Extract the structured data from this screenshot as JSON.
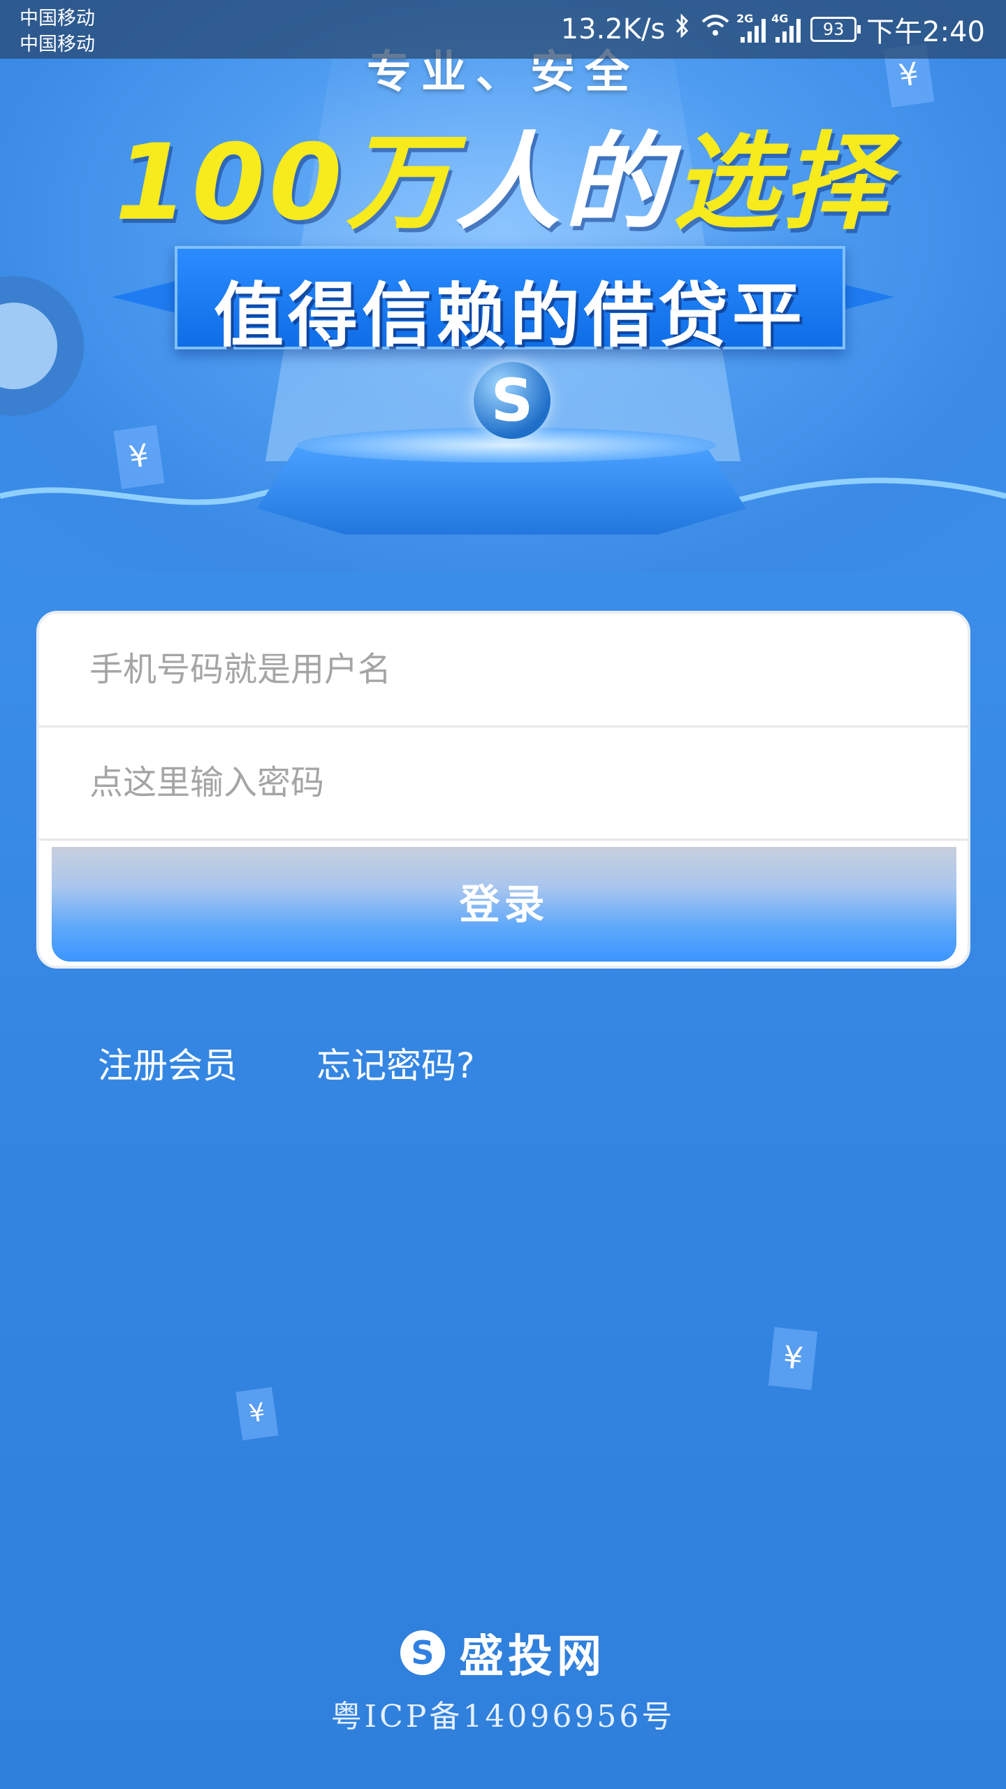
{
  "status_bar": {
    "carrier_1": "中国移动",
    "carrier_2": "中国移动",
    "net_speed": "13.2K/s",
    "signal_1_tag": "2G",
    "signal_2_tag": "4G",
    "battery": "93",
    "time": "下午2:40"
  },
  "banner": {
    "tagline": "专业、安全",
    "headline_part1": "100万",
    "headline_part2": "人的",
    "headline_part3": "选择",
    "ribbon_text": "值得信赖的借贷平台",
    "yen_symbol": "¥",
    "logo_letter": "S"
  },
  "login": {
    "username_placeholder": "手机号码就是用户名",
    "username_value": "",
    "password_placeholder": "点这里输入密码",
    "password_value": "",
    "login_label": "登录"
  },
  "links": {
    "register": "注册会员",
    "forgot_password": "忘记密码?"
  },
  "footer": {
    "brand_logo_letter": "S",
    "brand_name": "盛投网",
    "icp": "粤ICP备14096956号"
  },
  "colors": {
    "background": "#3b8ee9",
    "headline_yellow": "#f7ea1d",
    "ribbon": "#1a7cf0",
    "button": "#3b96ff"
  }
}
